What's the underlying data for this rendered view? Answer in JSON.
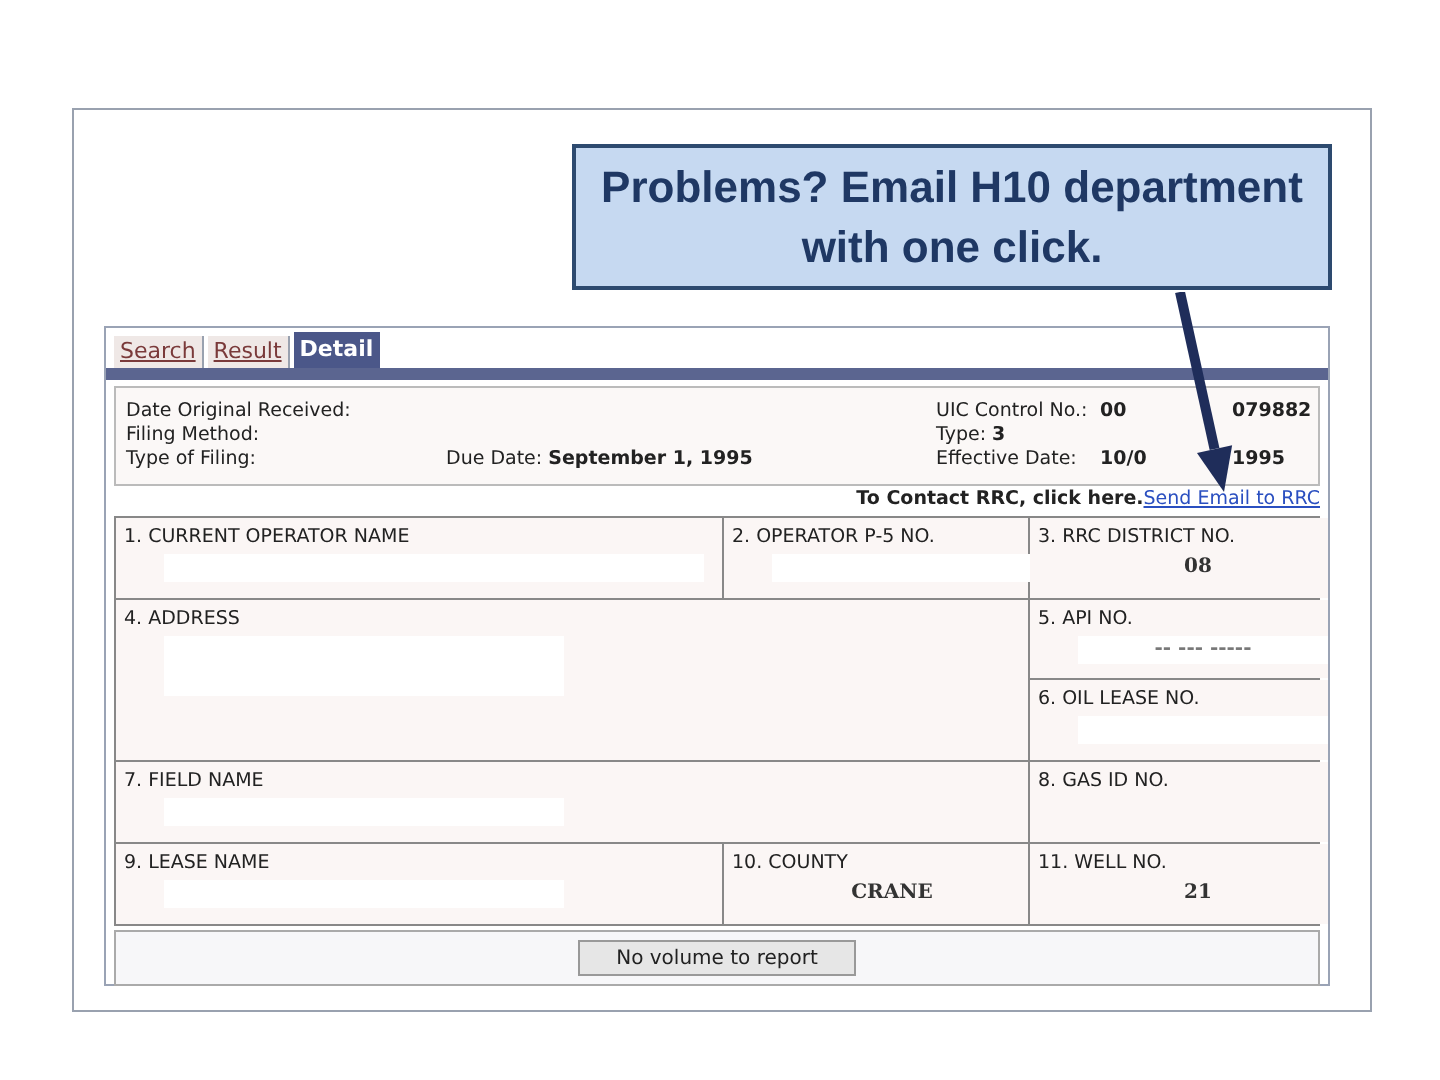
{
  "callout": {
    "text": "Problems? Email H10 department with one click."
  },
  "tabs": [
    {
      "label": "Search",
      "selected": false
    },
    {
      "label": "Result",
      "selected": false
    },
    {
      "label": "Detail",
      "selected": true
    }
  ],
  "header": {
    "left": [
      "Date Original Received:",
      "Filing Method:",
      "Type of Filing:"
    ],
    "due_date": {
      "label": "Due Date:",
      "value": "September 1, 1995"
    },
    "right": [
      {
        "label": "UIC Control No.:",
        "value_parts": [
          "00",
          "079882"
        ]
      },
      {
        "label": "Type:",
        "value_parts": [
          "3"
        ]
      },
      {
        "label": "Effective Date:",
        "value_parts": [
          "10/0",
          "1995"
        ]
      }
    ]
  },
  "contact": {
    "text": "To Contact RRC, click here.",
    "link": "Send Email to RRC"
  },
  "fields": [
    {
      "label": "1. CURRENT OPERATOR NAME",
      "redacted": true
    },
    {
      "label": "2. OPERATOR P-5 NO.",
      "redacted": true
    },
    {
      "label": "3. RRC DISTRICT NO.",
      "value": "08",
      "redacted": false
    },
    {
      "label": "4. ADDRESS",
      "redacted": true
    },
    {
      "label": "5. API NO.",
      "value": "-- --- -----",
      "redacted": true
    },
    {
      "label": "6. OIL LEASE NO.",
      "redacted": true
    },
    {
      "label": "7. FIELD NAME",
      "redacted": true
    },
    {
      "label": "8. GAS ID NO.",
      "redacted": false
    },
    {
      "label": "9. LEASE NAME",
      "redacted": true
    },
    {
      "label": "10. COUNTY",
      "value": "CRANE",
      "redacted": false
    },
    {
      "label": "11. WELL NO.",
      "value": "21",
      "redacted": false
    }
  ],
  "button": {
    "label": "No volume to report"
  }
}
